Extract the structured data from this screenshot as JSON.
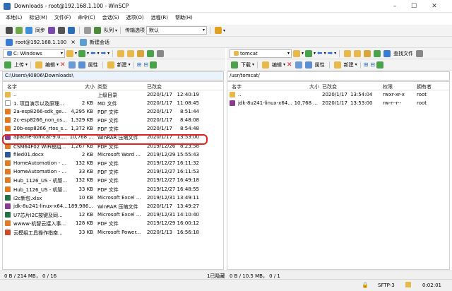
{
  "window": {
    "title": "Downloads - root@192.168.1.100 - WinSCP",
    "min": "–",
    "max": "☐",
    "close": "✕"
  },
  "menu": [
    "本地(L)",
    "标记(M)",
    "文件(F)",
    "命令(C)",
    "会话(S)",
    "选项(O)",
    "远程(R)",
    "帮助(H)"
  ],
  "toolbar1": {
    "sync_label": "同步",
    "queue_label": "队列",
    "transfer_label": "传输选项",
    "transfer_value": "默认"
  },
  "session_tab": {
    "label": "root@192.168.1.100",
    "new_session": "新建会话"
  },
  "left_nav": {
    "drive": "C: Windows"
  },
  "right_nav": {
    "dir": "tomcat",
    "find": "查找文件"
  },
  "left_actions": {
    "upload": "上传",
    "edit": "编辑",
    "properties": "属性",
    "new": "新建"
  },
  "right_actions": {
    "download": "下载",
    "edit": "编辑",
    "properties": "属性",
    "new": "新建"
  },
  "left_path": "C:\\Users\\40806\\Downloads\\",
  "right_path": "/usr/tomcat/",
  "left_columns": {
    "name": "名字",
    "size": "大小",
    "type": "类型",
    "changed": "已改变"
  },
  "right_columns": {
    "name": "名字",
    "size": "大小",
    "changed": "已改变",
    "rights": "权限",
    "owner": "拥有者"
  },
  "left_files": [
    {
      "name": "..",
      "size": "",
      "type": "上级目录",
      "date": "2020/1/17",
      "time": "12:40:19",
      "icon": "folder-up",
      "color": "#e8b84a"
    },
    {
      "name": "1. 项目演示以及原理...",
      "size": "2 KB",
      "type": "MD 文件",
      "date": "2020/1/17",
      "time": "11:08:45",
      "icon": "doc",
      "color": "#ffffff"
    },
    {
      "name": "2a-esp8266-sdk_ge...",
      "size": "4,295 KB",
      "type": "PDF 文件",
      "date": "2020/1/17",
      "time": "8:51:44",
      "icon": "pdf",
      "color": "#e07b22"
    },
    {
      "name": "2c-esp8266_non_os...",
      "size": "1,329 KB",
      "type": "PDF 文件",
      "date": "2020/1/17",
      "time": "8:48:08",
      "icon": "pdf",
      "color": "#e07b22"
    },
    {
      "name": "20b-esp8266_rtos_s...",
      "size": "1,372 KB",
      "type": "PDF 文件",
      "date": "2020/1/17",
      "time": "8:54:48",
      "icon": "pdf",
      "color": "#e07b22"
    },
    {
      "name": "apache-tomcat-9.0....",
      "size": "10,768 ...",
      "type": "WinRAR 压缩文件",
      "date": "2020/1/17",
      "time": "13:53:00",
      "icon": "archive",
      "color": "#8b3b8f"
    },
    {
      "name": "CSM64F02 WiFi模组...",
      "size": "1,267 KB",
      "type": "PDF 文件",
      "date": "2019/12/26",
      "time": "8:23:58",
      "icon": "pdf",
      "color": "#e07b22"
    },
    {
      "name": "filed01.docx",
      "size": "2 KB",
      "type": "Microsoft Word ...",
      "date": "2019/12/29",
      "time": "15:55:43",
      "icon": "word",
      "color": "#2b5797"
    },
    {
      "name": "HomeAutomation - ...",
      "size": "132 KB",
      "type": "PDF 文件",
      "date": "2019/12/27",
      "time": "16:11:32",
      "icon": "pdf",
      "color": "#e07b22"
    },
    {
      "name": "HomeAutomation - ...",
      "size": "33 KB",
      "type": "PDF 文件",
      "date": "2019/12/27",
      "time": "16:11:53",
      "icon": "pdf",
      "color": "#e07b22"
    },
    {
      "name": "Hub_1126_US - 机智...",
      "size": "132 KB",
      "type": "PDF 文件",
      "date": "2019/12/27",
      "time": "16:49:18",
      "icon": "pdf",
      "color": "#e07b22"
    },
    {
      "name": "Hub_1126_US - 机智...",
      "size": "33 KB",
      "type": "PDF 文件",
      "date": "2019/12/27",
      "time": "16:48:55",
      "icon": "pdf",
      "color": "#e07b22"
    },
    {
      "name": "i2c新包.xlsx",
      "size": "10 KB",
      "type": "Microsoft Excel ...",
      "date": "2019/12/31",
      "time": "13:49:11",
      "icon": "excel",
      "color": "#217346"
    },
    {
      "name": "jdk-8u241-linux-x64...",
      "size": "189,986...",
      "type": "WinRAR 压缩文件",
      "date": "2020/1/17",
      "time": "13:49:27",
      "icon": "archive",
      "color": "#8b3b8f"
    },
    {
      "name": "U7芯片I2C按键及同...",
      "size": "12 KB",
      "type": "Microsoft Excel ...",
      "date": "2019/12/31",
      "time": "14:10:40",
      "icon": "excel",
      "color": "#217346"
    },
    {
      "name": "wwww-机智云接入事...",
      "size": "128 KB",
      "type": "PDF 文件",
      "date": "2019/12/29",
      "time": "16:00:12",
      "icon": "pdf",
      "color": "#e07b22"
    },
    {
      "name": "云模组工具操作指南...",
      "size": "33 KB",
      "type": "Microsoft Power...",
      "date": "2020/1/13",
      "time": "16:56:18",
      "icon": "ppt",
      "color": "#d24726"
    }
  ],
  "right_files": [
    {
      "name": "..",
      "size": "",
      "date": "2020/1/17",
      "time": "13:54:04",
      "rights": "rwxr-xr-x",
      "owner": "root",
      "icon": "folder-up",
      "color": "#e8b84a"
    },
    {
      "name": "jdk-8u241-linux-x64...",
      "size": "10,768 ...",
      "date": "2020/1/17",
      "time": "13:53:00",
      "rights": "rw-r--r--",
      "owner": "root",
      "icon": "archive",
      "color": "#8b3b8f"
    }
  ],
  "status": {
    "left": "0 B / 214 MB，  0 / 16",
    "hidden": "1已隐藏",
    "right": "0 B / 10.5 MB，  0 / 1"
  },
  "bottom": {
    "lock": "🔒",
    "protocol": "SFTP-3",
    "time": "0:02:01"
  }
}
